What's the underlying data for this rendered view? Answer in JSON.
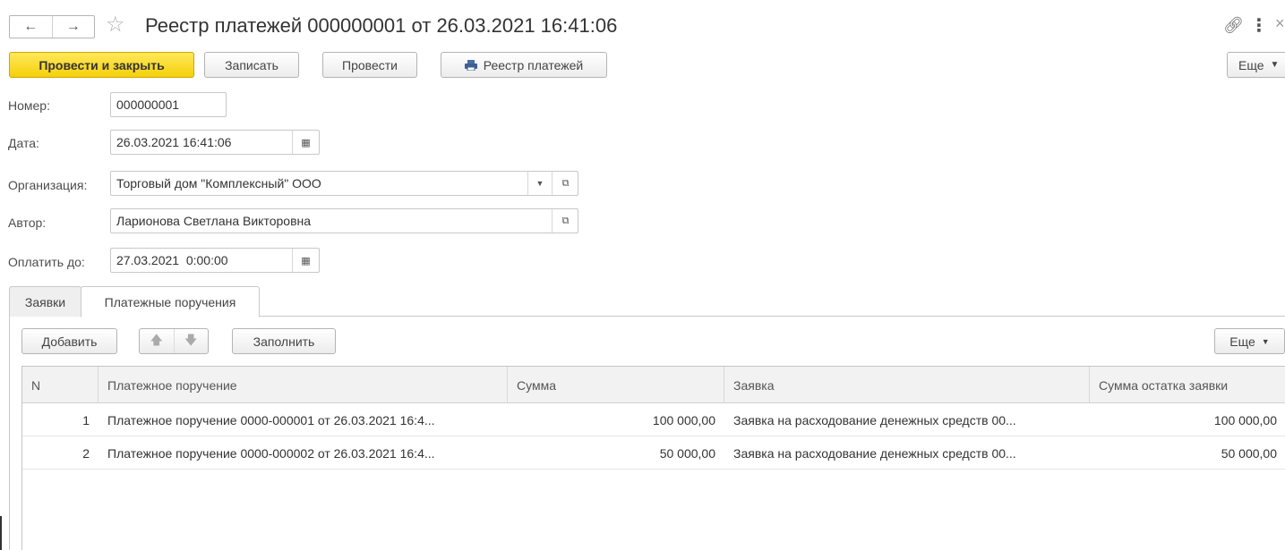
{
  "title": "Реестр платежей 000000001 от 26.03.2021 16:41:06",
  "toolbar": {
    "post_close": "Провести и закрыть",
    "save": "Записать",
    "post": "Провести",
    "registry": "Реестр платежей",
    "more": "Еще"
  },
  "form": {
    "number_label": "Номер:",
    "number_value": "000000001",
    "date_label": "Дата:",
    "date_value": "26.03.2021 16:41:06",
    "org_label": "Организация:",
    "org_value": "Торговый дом \"Комплексный\" ООО",
    "author_label": "Автор:",
    "author_value": "Ларионова Светлана Викторовна",
    "pay_until_label": "Оплатить до:",
    "pay_until_value": "27.03.2021  0:00:00"
  },
  "tabs": [
    {
      "label": "Заявки",
      "active": false
    },
    {
      "label": "Платежные поручения",
      "active": true
    }
  ],
  "table_toolbar": {
    "add": "Добавить",
    "fill": "Заполнить",
    "more": "Еще"
  },
  "table": {
    "columns": [
      "N",
      "Платежное поручение",
      "Сумма",
      "Заявка",
      "Сумма остатка заявки"
    ],
    "rows": [
      {
        "n": "1",
        "order": "Платежное поручение 0000-000001 от 26.03.2021 16:4...",
        "sum": "100 000,00",
        "request": "Заявка на расходование денежных средств 00...",
        "remainder": "100 000,00"
      },
      {
        "n": "2",
        "order": "Платежное поручение 0000-000002 от 26.03.2021 16:4...",
        "sum": "50 000,00",
        "request": "Заявка на расходование денежных средств 00...",
        "remainder": "50 000,00"
      }
    ]
  },
  "icons": [
    "back-arrow-icon",
    "forward-arrow-icon",
    "star-icon",
    "link-icon",
    "more-vertical-icon",
    "close-icon",
    "printer-icon",
    "calendar-icon",
    "dropdown-arrow-icon",
    "open-icon",
    "move-up-icon",
    "move-down-icon",
    "chevron-down-icon"
  ],
  "colors": {
    "primary_button": "#f5d009",
    "header_bg": "#f2f2f2"
  }
}
